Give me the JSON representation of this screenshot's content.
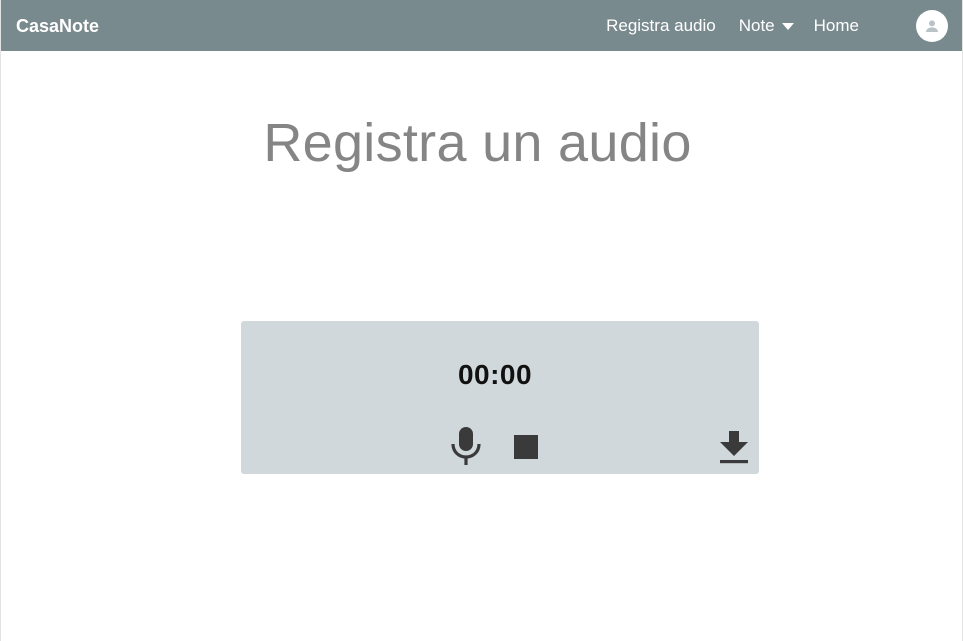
{
  "navbar": {
    "brand": "CasaNote",
    "links": {
      "registra_audio": "Registra audio",
      "note": "Note",
      "home": "Home"
    },
    "bg_color": "#798a8f"
  },
  "page": {
    "title": "Registra un audio"
  },
  "recorder": {
    "timer": "00:00",
    "controls": {
      "record": "microphone-icon",
      "stop": "stop-icon",
      "download": "download-icon"
    },
    "bg_color": "#d1d8dc"
  }
}
